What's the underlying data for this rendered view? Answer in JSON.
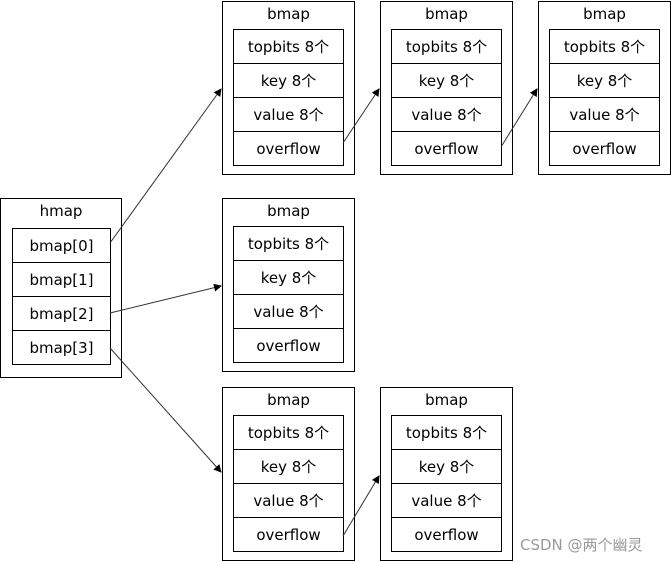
{
  "hmap": {
    "title": "hmap",
    "cells": [
      "bmap[0]",
      "bmap[1]",
      "bmap[2]",
      "bmap[3]"
    ]
  },
  "bmaps": [
    {
      "title": "bmap",
      "cells": [
        "topbits 8个",
        "key 8个",
        "value 8个",
        "overflow"
      ]
    },
    {
      "title": "bmap",
      "cells": [
        "topbits 8个",
        "key 8个",
        "value 8个",
        "overflow"
      ]
    },
    {
      "title": "bmap",
      "cells": [
        "topbits 8个",
        "key 8个",
        "value 8个",
        "overflow"
      ]
    },
    {
      "title": "bmap",
      "cells": [
        "topbits 8个",
        "key 8个",
        "value 8个",
        "overflow"
      ]
    },
    {
      "title": "bmap",
      "cells": [
        "topbits 8个",
        "key 8个",
        "value 8个",
        "overflow"
      ]
    },
    {
      "title": "bmap",
      "cells": [
        "topbits 8个",
        "key 8个",
        "value 8个",
        "overflow"
      ]
    }
  ],
  "watermark": "CSDN @两个幽灵"
}
